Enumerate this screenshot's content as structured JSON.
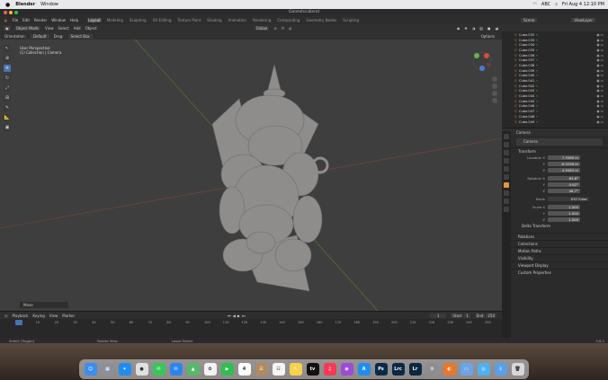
{
  "mac_menu": {
    "items": [
      "Blender",
      "Window"
    ],
    "datetime": "Fri Aug 4  12:10 PM",
    "abc": "ABC"
  },
  "window": {
    "title": "Ganesha.blend"
  },
  "top_menu": {
    "items": [
      "File",
      "Edit",
      "Render",
      "Window",
      "Help"
    ],
    "workspaces": [
      "Layout",
      "Modeling",
      "Sculpting",
      "UV Editing",
      "Texture Paint",
      "Shading",
      "Animation",
      "Rendering",
      "Compositing",
      "Geometry Nodes",
      "Scripting"
    ],
    "active_workspace": "Layout",
    "scene_label": "Scene",
    "viewlayer_label": "ViewLayer"
  },
  "viewport_header": {
    "mode": "Object Mode",
    "menus": [
      "View",
      "Select",
      "Add",
      "Object"
    ],
    "orientation_label": "Orientation:",
    "orientation_value": "Default",
    "drag_label": "Drag:",
    "drag_value": "Select Box",
    "transform_space": "Global",
    "options": "Options"
  },
  "viewport_overlay": {
    "perspective": "User Perspective",
    "collection": "(1) Collection | Camera",
    "move_panel": "Move"
  },
  "outliner": {
    "items": [
      "Cube.032",
      "Cube.033",
      "Cube.034",
      "Cube.035",
      "Cube.036",
      "Cube.037",
      "Cube.038",
      "Cube.039",
      "Cube.040",
      "Cube.041",
      "Cube.042",
      "Cube.043",
      "Cube.044",
      "Cube.045",
      "Cube.046",
      "Cube.047",
      "Cube.048",
      "Cube.049"
    ]
  },
  "properties": {
    "object_name": "Camera",
    "breadcrumb": "Camera",
    "transform_label": "Transform",
    "location": {
      "label": "Location X",
      "x": "7.3589 m",
      "y": "-6.9258 m",
      "z": "4.9583 m"
    },
    "rotation": {
      "label": "Rotation X",
      "x": "63.6°",
      "y": "0.62°",
      "z": "46.7°"
    },
    "mode": {
      "label": "Mode",
      "value": "XYZ Euler"
    },
    "scale": {
      "label": "Scale X",
      "x": "1.000",
      "y": "1.000",
      "z": "1.000"
    },
    "axis_labels": {
      "y": "Y",
      "z": "Z"
    },
    "sections": [
      "Delta Transform",
      "Relations",
      "Collections",
      "Motion Paths",
      "Visibility",
      "Viewport Display",
      "Custom Properties"
    ]
  },
  "timeline": {
    "menus": [
      "Playback",
      "Keying",
      "View",
      "Marker"
    ],
    "current_frame": "1",
    "start_label": "Start",
    "start": "1",
    "end_label": "End",
    "end": "250",
    "ruler": [
      "0",
      "10",
      "20",
      "30",
      "40",
      "50",
      "60",
      "70",
      "80",
      "90",
      "100",
      "110",
      "120",
      "130",
      "140",
      "150",
      "160",
      "170",
      "180",
      "190",
      "200",
      "210",
      "220",
      "230",
      "240",
      "250"
    ]
  },
  "statusbar": {
    "items": [
      "Select (Toggle)",
      "Rotate View",
      "Lasso Select"
    ],
    "version": "3.6.1"
  },
  "dock": {
    "apps": [
      {
        "name": "Finder",
        "color": "#3b8df1",
        "glyph": "☺"
      },
      {
        "name": "Launchpad",
        "color": "#8a8f9a",
        "glyph": "▦"
      },
      {
        "name": "Safari",
        "color": "#1d8cf8",
        "glyph": "✦"
      },
      {
        "name": "Chrome",
        "color": "#e0e0e0",
        "glyph": "●"
      },
      {
        "name": "Messages",
        "color": "#35c759",
        "glyph": "✉"
      },
      {
        "name": "Mail",
        "color": "#2b85f0",
        "glyph": "✉"
      },
      {
        "name": "Maps",
        "color": "#55b86a",
        "glyph": "▲"
      },
      {
        "name": "Photos",
        "color": "#f3f3f3",
        "glyph": "✿"
      },
      {
        "name": "FaceTime",
        "color": "#2fbf4e",
        "glyph": "▶"
      },
      {
        "name": "Calendar",
        "color": "#ffffff",
        "glyph": "4"
      },
      {
        "name": "Contacts",
        "color": "#b08a62",
        "glyph": "☰"
      },
      {
        "name": "Reminders",
        "color": "#f5f5f5",
        "glyph": "☷"
      },
      {
        "name": "Notes",
        "color": "#f6d24a",
        "glyph": "✎"
      },
      {
        "name": "TV",
        "color": "#111111",
        "glyph": "tv"
      },
      {
        "name": "Music",
        "color": "#fb3a55",
        "glyph": "♫"
      },
      {
        "name": "Podcasts",
        "color": "#9b4bd8",
        "glyph": "◉"
      },
      {
        "name": "App Store",
        "color": "#1f8ef3",
        "glyph": "A"
      },
      {
        "name": "Photoshop",
        "color": "#0a2a4a",
        "glyph": "Ps"
      },
      {
        "name": "Lightroom Classic",
        "color": "#0b2842",
        "glyph": "Lrc"
      },
      {
        "name": "Lightroom",
        "color": "#0b2842",
        "glyph": "Lr"
      },
      {
        "name": "Settings",
        "color": "#8d8d93",
        "glyph": "⚙"
      },
      {
        "name": "Blender",
        "color": "#e8782a",
        "glyph": "◐"
      },
      {
        "name": "Preview",
        "color": "#6aa5e8",
        "glyph": "▭"
      },
      {
        "name": "Browser",
        "color": "#4cb1f2",
        "glyph": "◎"
      },
      {
        "name": "Downloads",
        "color": "#5aa0e8",
        "glyph": "⇩"
      },
      {
        "name": "Trash",
        "color": "#d8d8dc",
        "glyph": "🗑"
      }
    ]
  }
}
